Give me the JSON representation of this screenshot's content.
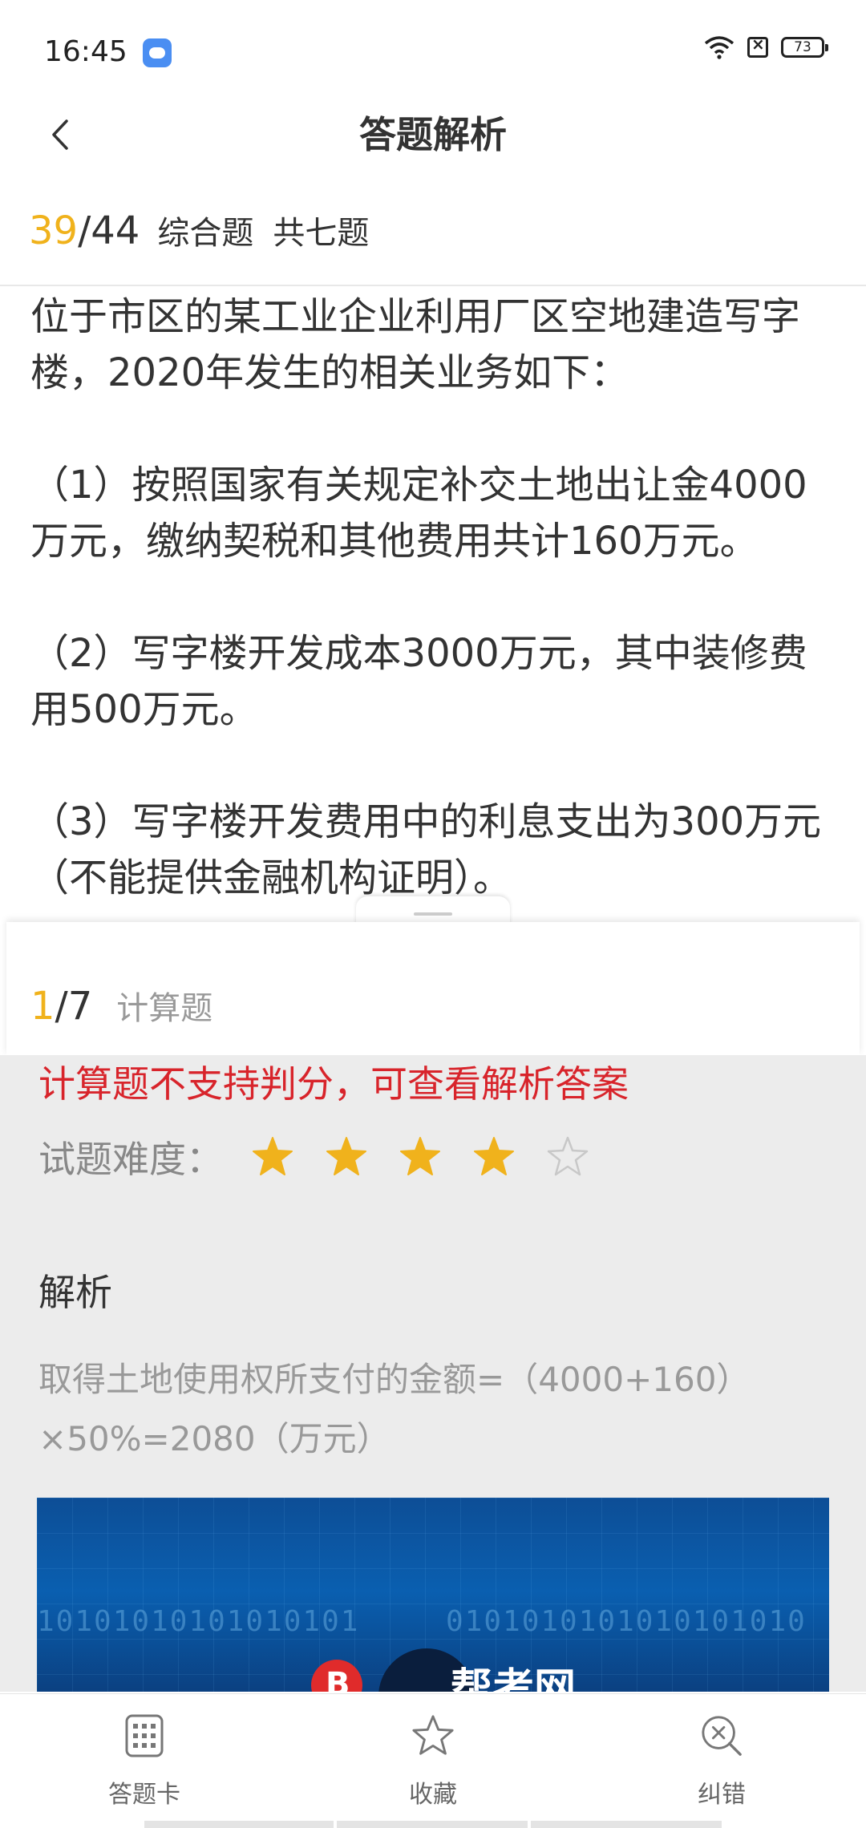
{
  "status": {
    "time": "16:45",
    "battery": "73"
  },
  "header": {
    "title": "答题解析"
  },
  "progress": {
    "current": "39",
    "total": "/44",
    "type": "综合题",
    "count": "共七题"
  },
  "question": {
    "paragraphs": [
      "位于市区的某工业企业利用厂区空地建造写字楼，2020年发生的相关业务如下：",
      "（1）按照国家有关规定补交土地出让金4000万元，缴纳契税和其他费用共计160万元。",
      "（2）写字楼开发成本3000万元，其中装修费用500万元。",
      "（3）写字楼开发费用中的利息支出为300万元（不能提供金融机构证明）。"
    ]
  },
  "sub_question": {
    "current": "1",
    "total": "/7",
    "type": "计算题"
  },
  "analysis": {
    "notice": "计算题不支持判分，可查看解析答案",
    "difficulty_label": "试题难度：",
    "difficulty_rating": 4,
    "difficulty_max": 5,
    "heading": "解析",
    "text": "取得土地使用权所支付的金额=（4000+160）×50%=2080（万元）"
  },
  "banner": {
    "binary_left": "10101010101010101",
    "binary_right": "0101010101010101010",
    "brand": "帮考网"
  },
  "tabs": [
    {
      "label": "答题卡",
      "icon": "answer-card-icon"
    },
    {
      "label": "收藏",
      "icon": "star-icon"
    },
    {
      "label": "纠错",
      "icon": "error-report-icon"
    }
  ],
  "colors": {
    "accent": "#f0b21c",
    "notice": "#d8242b",
    "panel": "#ececec"
  }
}
